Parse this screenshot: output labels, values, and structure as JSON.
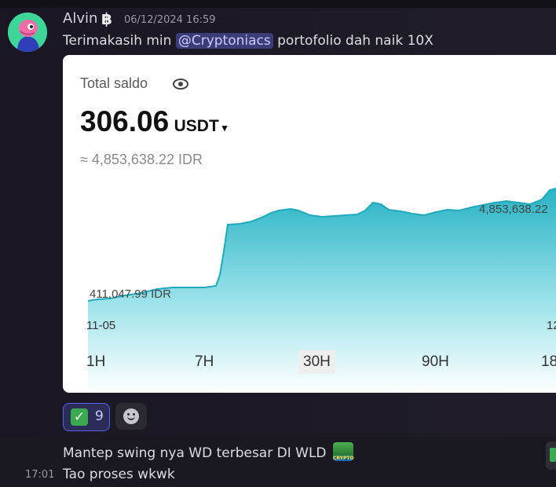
{
  "message": {
    "username": "Alvin",
    "badge": "฿",
    "timestamp": "06/12/2024 16:59",
    "text_before": "Terimakasih min ",
    "mention": "@Cryptoniacs",
    "text_after": "  portofolio dah naik 10X"
  },
  "card": {
    "total_label": "Total saldo",
    "balance_value": "306.06",
    "balance_currency": "USDT",
    "balance_caret": "▾",
    "approx_value": "≈ 4,853,638.22 IDR",
    "low_label": "411,047.99 IDR",
    "high_label": "4,853,638.22",
    "x_ticks": [
      "11-05",
      "12"
    ],
    "tabs": [
      "1H",
      "7H",
      "30H",
      "90H",
      "18"
    ],
    "active_tab": "30H",
    "accent_color": "#1fa9bd"
  },
  "reactions": {
    "check_count": "9"
  },
  "messages": [
    {
      "text": "Mantep swing nya WD terbesar DI WLD",
      "emoji_label": "CRYPTO"
    },
    {
      "time": "17:01",
      "text": "Tao proses wkwk"
    }
  ]
}
